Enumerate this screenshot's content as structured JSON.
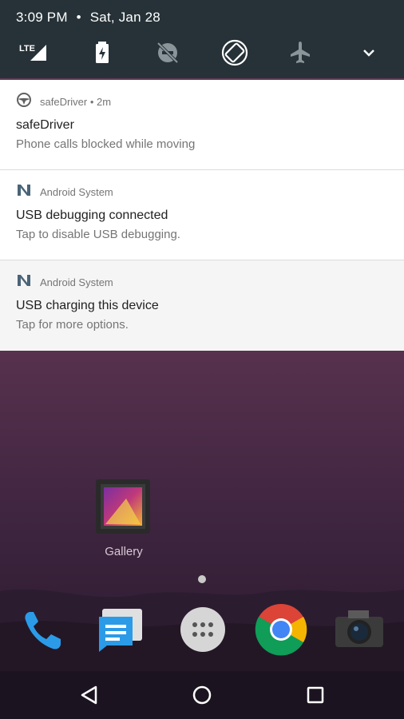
{
  "status": {
    "time": "3:09 PM",
    "separator": "•",
    "date": "Sat, Jan 28"
  },
  "quick_settings": [
    {
      "icon": "lte-signal-icon"
    },
    {
      "icon": "battery-charging-icon"
    },
    {
      "icon": "do-not-disturb-off-icon"
    },
    {
      "icon": "auto-rotate-icon"
    },
    {
      "icon": "airplane-mode-icon"
    },
    {
      "icon": "expand-chevron-icon"
    }
  ],
  "notifications": [
    {
      "app": "safeDriver • 2m",
      "icon": "steering-wheel-icon",
      "title": "safeDriver",
      "text": "Phone calls blocked while moving"
    },
    {
      "app": "Android System",
      "icon": "android-n-icon",
      "title": "USB debugging connected",
      "text": "Tap to disable USB debugging."
    },
    {
      "app": "Android System",
      "icon": "android-n-icon",
      "title": "USB charging this device",
      "text": "Tap for more options."
    }
  ],
  "home": {
    "gallery_label": "Gallery",
    "dock": [
      "phone-icon",
      "messages-icon",
      "app-drawer-icon",
      "chrome-icon",
      "camera-icon"
    ]
  },
  "navbar": [
    "back-icon",
    "home-icon",
    "recents-icon"
  ],
  "colors": {
    "shade_header": "#263238",
    "notification_bg": "#ffffff",
    "accent_blue": "#1e88e5"
  }
}
